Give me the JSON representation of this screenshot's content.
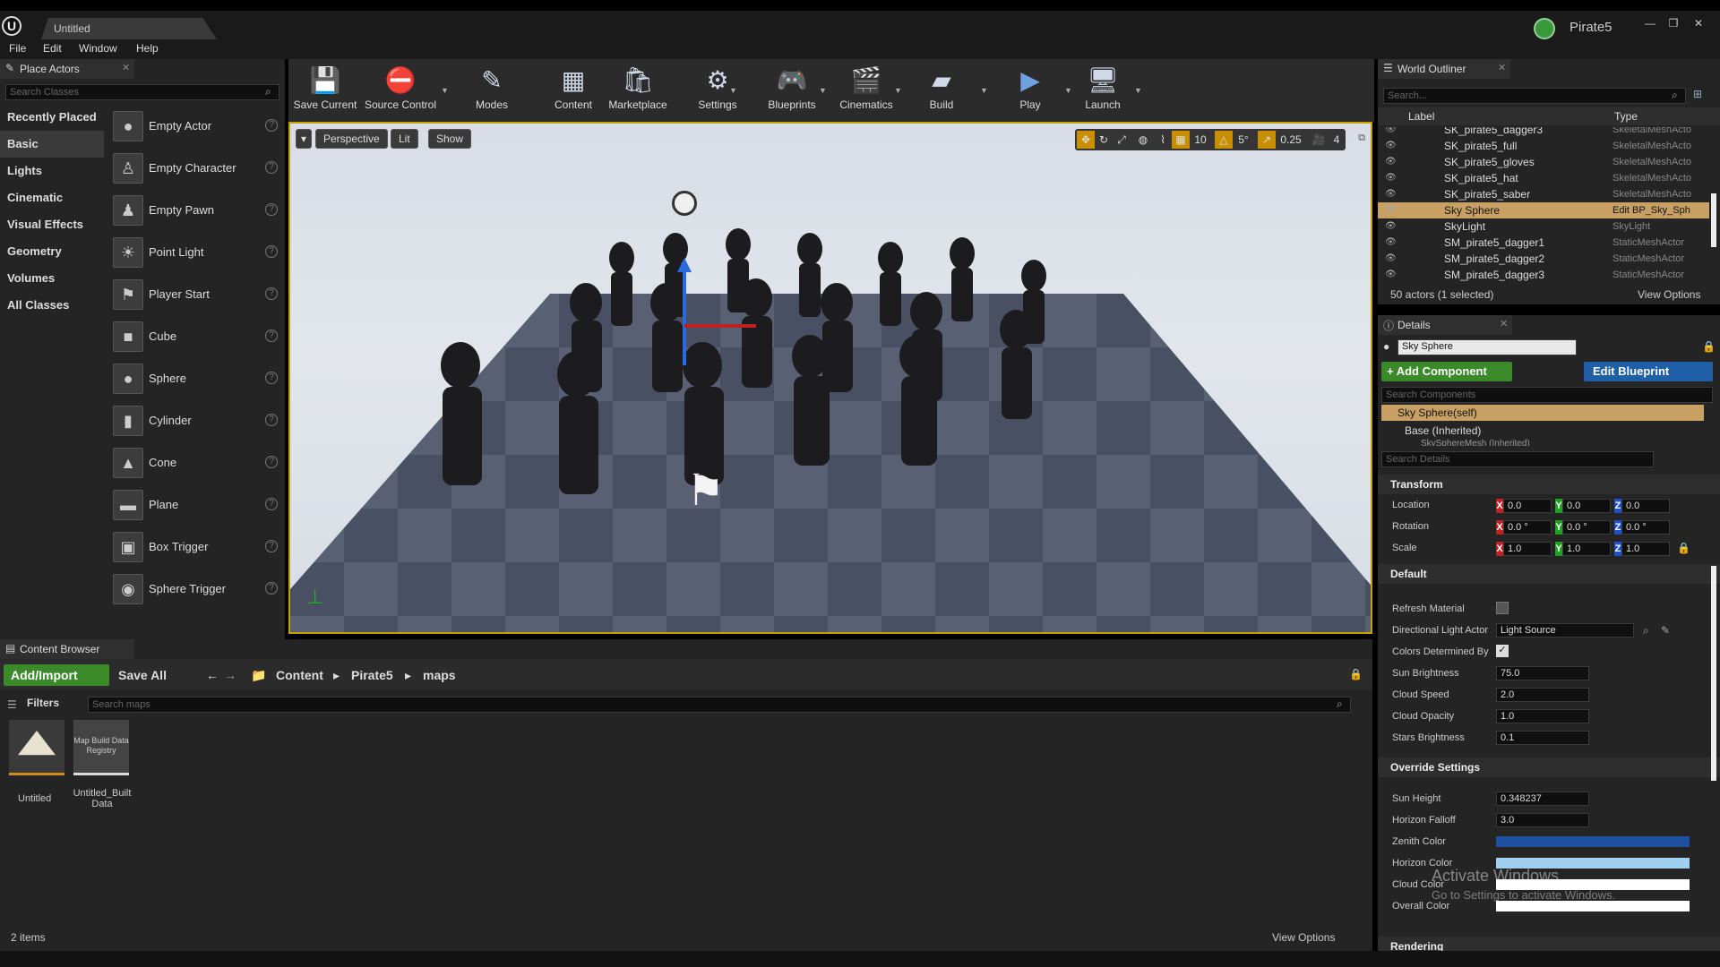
{
  "window": {
    "doc_tab": "Untitled",
    "project_name": "Pirate5",
    "min": "—",
    "max": "❐",
    "close": "✕"
  },
  "menu": [
    "File",
    "Edit",
    "Window",
    "Help"
  ],
  "place_actors": {
    "tab_label": "Place Actors",
    "search_placeholder": "Search Classes",
    "categories": [
      "Recently Placed",
      "Basic",
      "Lights",
      "Cinematic",
      "Visual Effects",
      "Geometry",
      "Volumes",
      "All Classes"
    ],
    "selected_category": "Basic",
    "actors": [
      {
        "label": "Empty Actor",
        "icon": "sphere-icon"
      },
      {
        "label": "Empty Character",
        "icon": "character-icon"
      },
      {
        "label": "Empty Pawn",
        "icon": "pawn-icon"
      },
      {
        "label": "Point Light",
        "icon": "light-bulb-icon"
      },
      {
        "label": "Player Start",
        "icon": "flag-icon"
      },
      {
        "label": "Cube",
        "icon": "cube-icon"
      },
      {
        "label": "Sphere",
        "icon": "sphere-icon"
      },
      {
        "label": "Cylinder",
        "icon": "cylinder-icon"
      },
      {
        "label": "Cone",
        "icon": "cone-icon"
      },
      {
        "label": "Plane",
        "icon": "plane-icon"
      },
      {
        "label": "Box Trigger",
        "icon": "box-trigger-icon"
      },
      {
        "label": "Sphere Trigger",
        "icon": "sphere-trigger-icon"
      }
    ],
    "help_glyph": "?"
  },
  "toolbar": {
    "buttons": [
      {
        "label": "Save Current",
        "icon": "save-icon"
      },
      {
        "label": "Source Control",
        "icon": "source-control-icon"
      },
      {
        "label": "Modes",
        "icon": "modes-icon"
      },
      {
        "label": "Content",
        "icon": "content-icon"
      },
      {
        "label": "Marketplace",
        "icon": "marketplace-icon"
      },
      {
        "label": "Settings",
        "icon": "settings-icon"
      },
      {
        "label": "Blueprints",
        "icon": "blueprints-icon"
      },
      {
        "label": "Cinematics",
        "icon": "cinematics-icon"
      },
      {
        "label": "Build",
        "icon": "build-icon"
      },
      {
        "label": "Play",
        "icon": "play-icon"
      },
      {
        "label": "Launch",
        "icon": "launch-icon"
      }
    ]
  },
  "viewport": {
    "perspective_label": "Perspective",
    "lit_label": "Lit",
    "show_label": "Show",
    "grid_snap": "10",
    "rotation_snap": "5°",
    "scale_snap": "0.25",
    "camera_speed": "4"
  },
  "outliner": {
    "tab_label": "World Outliner",
    "search_placeholder": "Search...",
    "col_label": "Label",
    "col_type": "Type",
    "rows": [
      {
        "label": "SK_pirate5_dagger3",
        "type": "SkeletalMeshActo"
      },
      {
        "label": "SK_pirate5_full",
        "type": "SkeletalMeshActo"
      },
      {
        "label": "SK_pirate5_gloves",
        "type": "SkeletalMeshActo"
      },
      {
        "label": "SK_pirate5_hat",
        "type": "SkeletalMeshActo"
      },
      {
        "label": "SK_pirate5_saber",
        "type": "SkeletalMeshActo"
      },
      {
        "label": "Sky Sphere",
        "type": "Edit BP_Sky_Sph"
      },
      {
        "label": "SkyLight",
        "type": "SkyLight"
      },
      {
        "label": "SM_pirate5_dagger1",
        "type": "StaticMeshActor"
      },
      {
        "label": "SM_pirate5_dagger2",
        "type": "StaticMeshActor"
      },
      {
        "label": "SM_pirate5_dagger3",
        "type": "StaticMeshActor"
      }
    ],
    "selected_row": 5,
    "status": "50 actors (1 selected)",
    "view_options": "View Options"
  },
  "details": {
    "tab_label": "Details",
    "name_value": "Sky Sphere",
    "add_component": "+ Add Component",
    "edit_blueprint": "Edit Blueprint",
    "search_components_placeholder": "Search Components",
    "component_self": "Sky Sphere(self)",
    "component_base": "Base (Inherited)",
    "component_mesh": "SkySphereMesh (Inherited)",
    "search_details_placeholder": "Search Details",
    "transform": {
      "header": "Transform",
      "location_label": "Location",
      "rotation_label": "Rotation",
      "scale_label": "Scale",
      "location": [
        "0.0",
        "0.0",
        "0.0"
      ],
      "rotation": [
        "0.0 °",
        "0.0 °",
        "0.0 °"
      ],
      "scale": [
        "1.0",
        "1.0",
        "1.0"
      ],
      "axes": [
        "X",
        "Y",
        "Z"
      ]
    },
    "default": {
      "header": "Default",
      "refresh_material": "Refresh Material",
      "directional_light_actor": "Directional Light Actor",
      "light_source_value": "Light Source",
      "colors_determined_by": "Colors Determined By",
      "sun_brightness_label": "Sun Brightness",
      "sun_brightness": "75.0",
      "cloud_speed_label": "Cloud Speed",
      "cloud_speed": "2.0",
      "cloud_opacity_label": "Cloud Opacity",
      "cloud_opacity": "1.0",
      "stars_brightness_label": "Stars Brightness",
      "stars_brightness": "0.1"
    },
    "override": {
      "header": "Override Settings",
      "sun_height_label": "Sun Height",
      "sun_height": "0.348237",
      "horizon_falloff_label": "Horizon Falloff",
      "horizon_falloff": "3.0",
      "zenith_color_label": "Zenith Color",
      "horizon_color_label": "Horizon Color",
      "cloud_color_label": "Cloud Color",
      "overall_color_label": "Overall Color",
      "zenith_color": "#1f4f9f",
      "horizon_color": "#9fd0f0",
      "cloud_color": "#ffffff",
      "overall_color": "#ffffff"
    },
    "rendering_header": "Rendering"
  },
  "content_browser": {
    "tab_label": "Content Browser",
    "add_import": "Add/Import",
    "save_all": "Save All",
    "breadcrumbs": [
      "Content",
      "Pirate5",
      "maps"
    ],
    "filters": "Filters",
    "search_placeholder": "Search maps",
    "assets": [
      {
        "label": "Untitled",
        "thumb_text": ""
      },
      {
        "label": "Untitled_Built Data",
        "thumb_text": "Map Build Data Registry"
      }
    ],
    "item_count": "2 items",
    "view_options": "View Options"
  },
  "watermark": {
    "line1": "Activate Windows",
    "line2": "Go to Settings to activate Windows."
  },
  "colors": {
    "accent_green": "#3a8a2a",
    "accent_blue": "#1f5fa8",
    "selection": "#c8a064",
    "viewport_border": "#c8a000"
  }
}
